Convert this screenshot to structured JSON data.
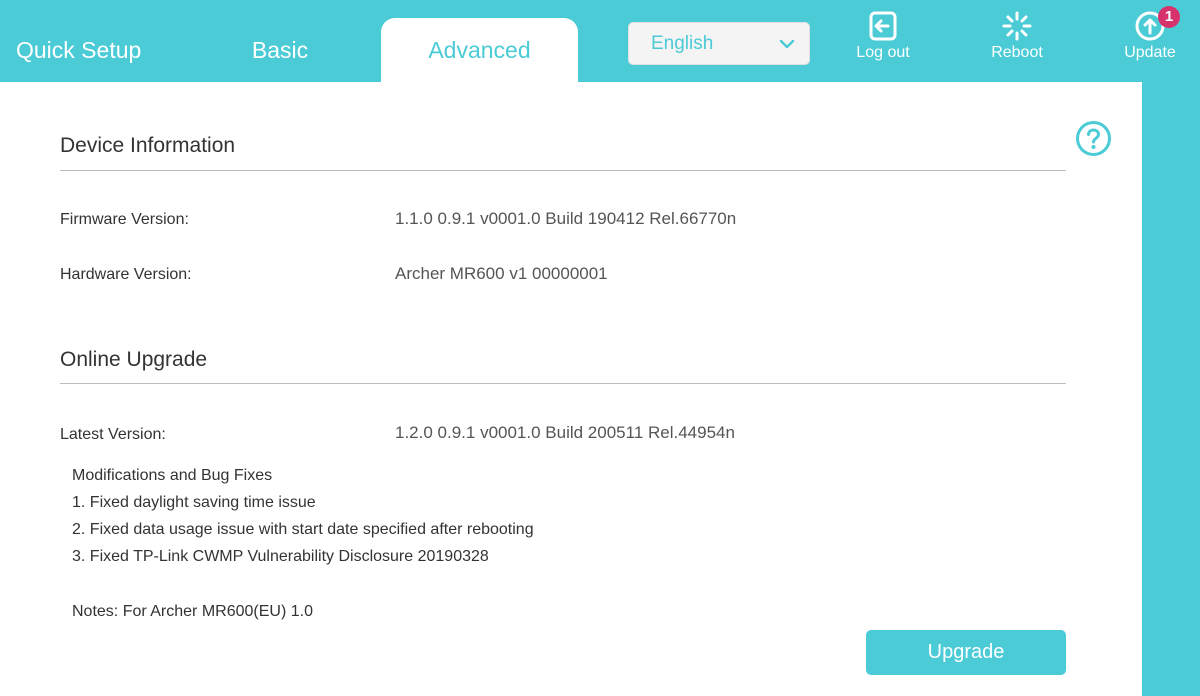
{
  "nav": {
    "tabs": [
      {
        "label": "Quick Setup"
      },
      {
        "label": "Basic"
      },
      {
        "label": "Advanced",
        "active": true
      }
    ],
    "language": {
      "selected": "English"
    },
    "tools": {
      "logout": {
        "label": "Log out",
        "icon": "logout-icon"
      },
      "reboot": {
        "label": "Reboot",
        "icon": "reboot-icon"
      },
      "update": {
        "label": "Update",
        "icon": "update-icon",
        "badge": "1"
      }
    }
  },
  "device_info": {
    "title": "Device Information",
    "firmware_label": "Firmware Version:",
    "firmware_value": "1.1.0 0.9.1 v0001.0 Build 190412 Rel.66770n",
    "hardware_label": "Hardware Version:",
    "hardware_value": "Archer MR600 v1 00000001"
  },
  "online_upgrade": {
    "title": "Online Upgrade",
    "latest_label": "Latest Version:",
    "latest_value": "1.2.0 0.9.1 v0001.0 Build 200511 Rel.44954n",
    "notes_lines": [
      "Modifications and Bug Fixes",
      "1. Fixed daylight saving time issue",
      "2. Fixed data usage issue with start date specified after rebooting",
      "3. Fixed TP-Link CWMP Vulnerability Disclosure 20190328"
    ],
    "notes_footer": "Notes: For Archer MR600(EU) 1.0",
    "upgrade_button": "Upgrade"
  },
  "colors": {
    "accent": "#4acbd6",
    "badge": "#d6336c"
  }
}
